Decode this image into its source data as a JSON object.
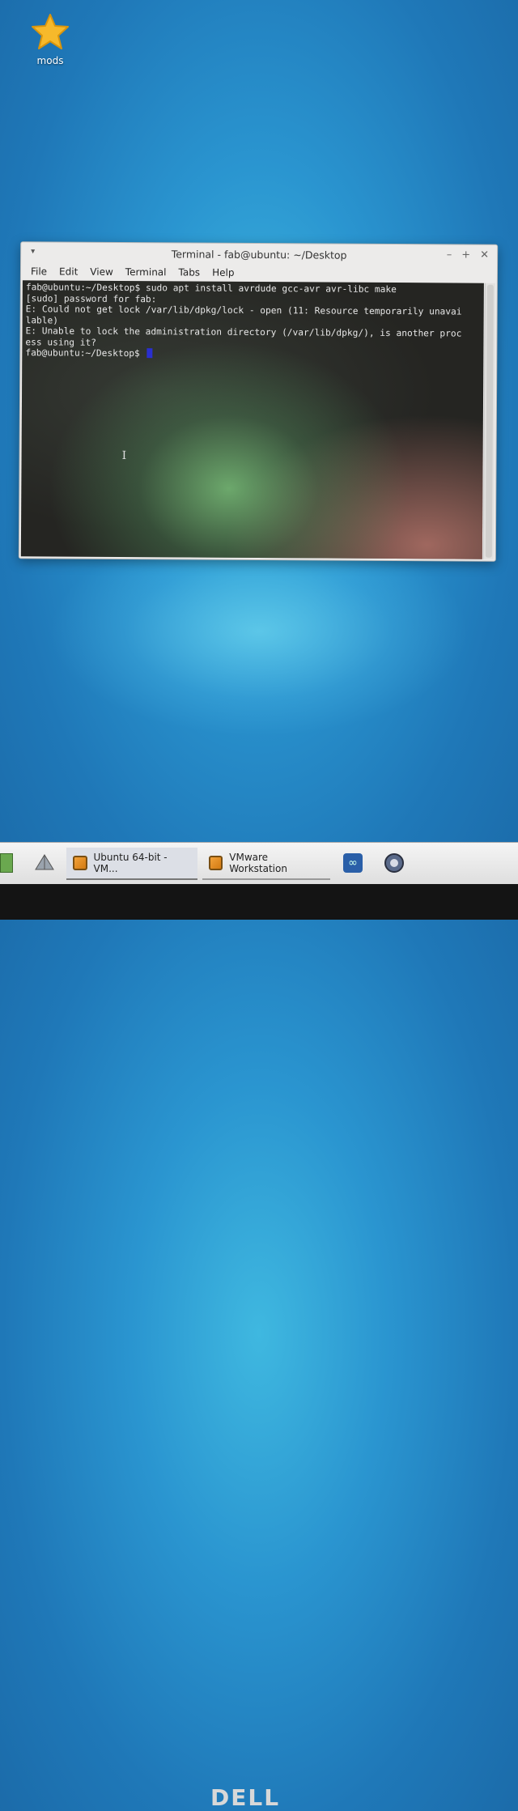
{
  "desktop": {
    "icons": [
      {
        "label": "mods",
        "icon": "star-icon"
      }
    ]
  },
  "window": {
    "title": "Terminal - fab@ubuntu: ~/Desktop",
    "menu_button_glyph": "▾",
    "buttons": {
      "minimize": "–",
      "maximize": "+",
      "close": "✕"
    },
    "menu": [
      "File",
      "Edit",
      "View",
      "Terminal",
      "Tabs",
      "Help"
    ]
  },
  "terminal": {
    "lines": [
      "fab@ubuntu:~/Desktop$ sudo apt install avrdude gcc-avr avr-libc make",
      "[sudo] password for fab:",
      "E: Could not get lock /var/lib/dpkg/lock - open (11: Resource temporarily unavai",
      "lable)",
      "E: Unable to lock the administration directory (/var/lib/dpkg/), is another proc",
      "ess using it?"
    ],
    "prompt": "fab@ubuntu:~/Desktop$ ",
    "ibeam": "I",
    "cursor_color": "#2a2fd0"
  },
  "taskbar": {
    "apps": [
      {
        "label": "Ubuntu 64-bit - VM...",
        "icon": "vmware-icon",
        "active": true
      },
      {
        "label": "VMware Workstation",
        "icon": "vmware-icon",
        "active": false
      }
    ]
  },
  "bezel": {
    "brand": "DELL"
  }
}
